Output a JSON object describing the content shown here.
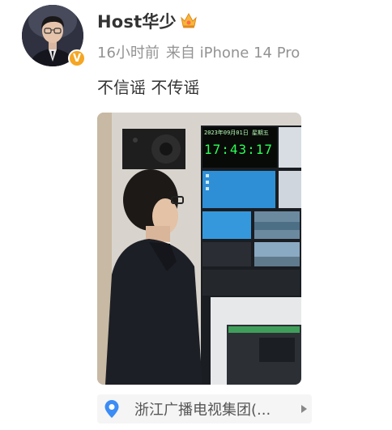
{
  "post": {
    "username": "Host华少",
    "time": "16小时前",
    "source": "来自 iPhone 14 Pro",
    "text": "不信谣 不传谣"
  },
  "photo": {
    "clock_date": "2023年09月01日 星期五",
    "clock_time": "17:43:17"
  },
  "location": {
    "label": "浙江广播电视集团(..."
  },
  "icons": {
    "verified": "verified-badge-icon",
    "crown": "crown-icon",
    "location": "location-pin-icon",
    "arrow": "chevron-right-icon"
  },
  "colors": {
    "verified_badge": "#f5a623",
    "location_pin": "#3b8cf5",
    "clock_digits": "#2cff55"
  }
}
